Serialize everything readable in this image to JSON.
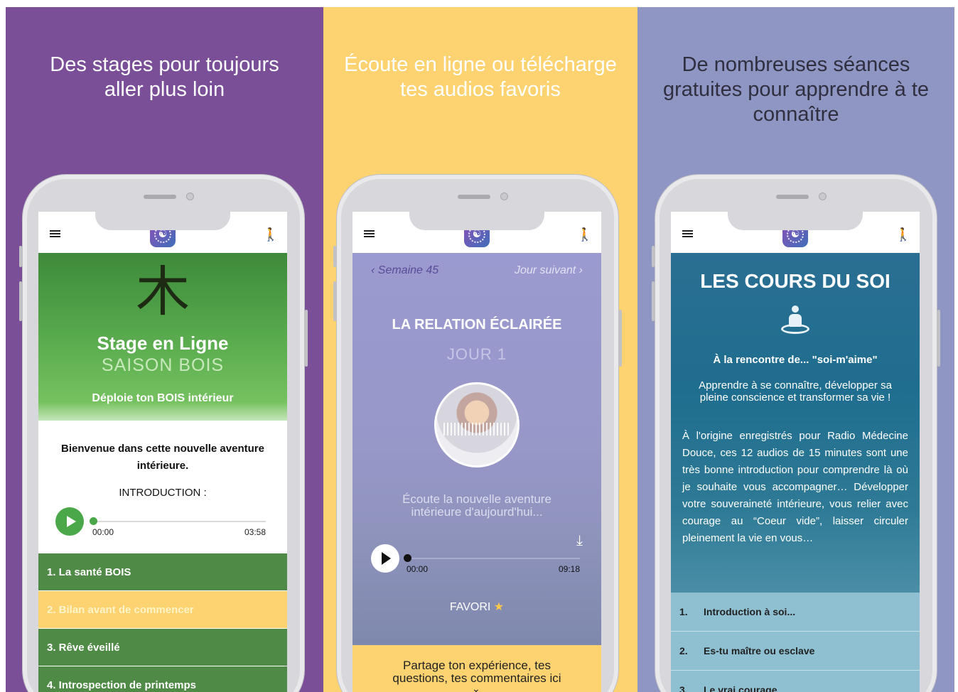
{
  "colors": {
    "purple": "#7a4f98",
    "yellow": "#fdd371",
    "lavender": "#9096c4",
    "green_play": "#4aa849",
    "list_green": "#4f8a46",
    "teal": "#1f6d8f"
  },
  "panels": [
    {
      "headline_line1": "Des stages pour toujours",
      "headline_line2": "aller plus loin"
    },
    {
      "headline_line1": "Écoute en ligne ou télécharge",
      "headline_line2": "tes audios favoris"
    },
    {
      "headline_line1": "De nombreuses séances",
      "headline_line2": "gratuites pour apprendre à te",
      "headline_line3": "connaître"
    }
  ],
  "icons": {
    "menu": "hamburger-menu-icon",
    "logo": "yin-yang-logo-icon",
    "person": "person-icon",
    "logo_glyph": "☯",
    "person_glyph": "🯅"
  },
  "screen1": {
    "kanji": "木",
    "title": "Stage en Ligne",
    "season": "SAISON BOIS",
    "tagline": "Déploie ton BOIS intérieur",
    "welcome": "Bienvenue dans cette nouvelle aventure intérieure.",
    "intro": "INTRODUCTION :",
    "player": {
      "start": "00:00",
      "end": "03:58",
      "progress": 0
    },
    "items": [
      {
        "label": "1.  La santé BOIS",
        "style": "green"
      },
      {
        "label": "2.  Bilan avant de commencer",
        "style": "yellow"
      },
      {
        "label": "3.  Rêve éveillé",
        "style": "green"
      },
      {
        "label": "4.  Introspection de printemps",
        "style": "green"
      }
    ]
  },
  "screen2": {
    "prev": "‹ Semaine 45",
    "next": "Jour suivant ›",
    "title": "LA RELATION ÉCLAIRÉE",
    "day": "JOUR 1",
    "description": "Écoute la nouvelle aventure intérieure d'aujourd'hui...",
    "download_glyph": "⤓",
    "player": {
      "start": "00:00",
      "end": "09:18",
      "progress": 0
    },
    "favorite": "FAVORI",
    "star_glyph": "★",
    "share": "Partage ton expérience, tes questions, tes commentaires ici",
    "chevron_glyph": "⌄"
  },
  "screen3": {
    "title": "LES COURS DU SOI",
    "subtitle": "À la rencontre de... \"soi-m'aime\"",
    "lead": "Apprendre à se connaître, développer sa pleine conscience et transformer sa vie !",
    "body": "À l'origine enregistrés pour Radio Médecine Douce, ces 12 audios de 15 minutes sont une très bonne introduction pour comprendre là où je souhaite vous accompagner… Développer votre souveraineté intérieure, vous relier avec courage au “Coeur vide”, laisser circuler pleinement la vie en vous…",
    "items": [
      {
        "num": "1.",
        "label": "Introduction à soi..."
      },
      {
        "num": "2.",
        "label": "Es-tu maître ou esclave"
      },
      {
        "num": "3.",
        "label": "Le vrai courage"
      }
    ]
  }
}
